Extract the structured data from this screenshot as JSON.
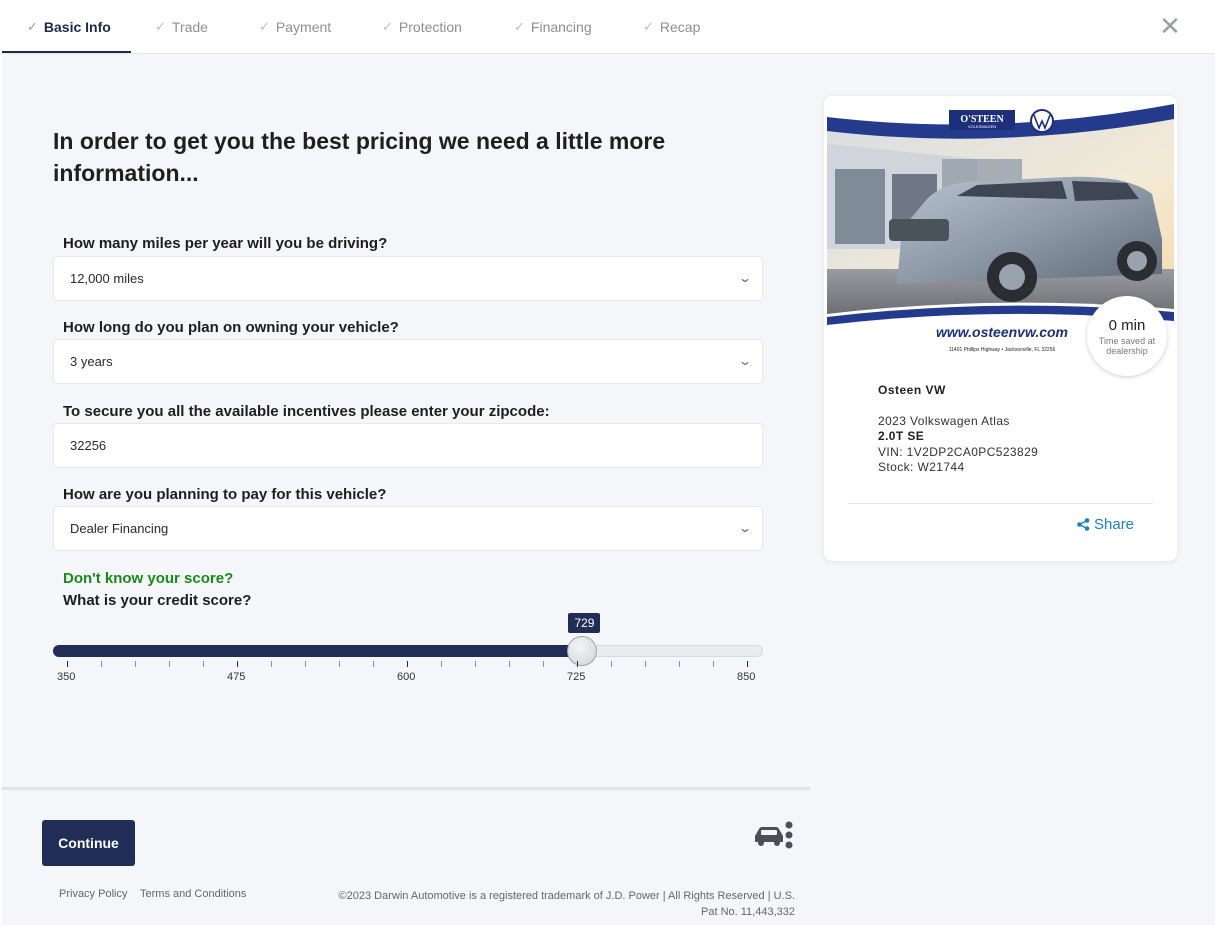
{
  "tabs": [
    {
      "label": "Basic Info",
      "active": true
    },
    {
      "label": "Trade",
      "active": false
    },
    {
      "label": "Payment",
      "active": false
    },
    {
      "label": "Protection",
      "active": false
    },
    {
      "label": "Financing",
      "active": false
    },
    {
      "label": "Recap",
      "active": false
    }
  ],
  "heading": "In order to get you the best pricing we need a little more information...",
  "questions": {
    "miles": {
      "label": "How many miles per year will you be driving?",
      "value": "12,000 miles"
    },
    "owning": {
      "label": "How long do you plan on owning your vehicle?",
      "value": "3 years"
    },
    "zipcode": {
      "label": "To secure you all the available incentives please enter your zipcode:",
      "value": "32256"
    },
    "payment": {
      "label": "How are you planning to pay for this vehicle?",
      "value": "Dealer Financing"
    }
  },
  "credit": {
    "link": "Don't know your score?",
    "label": "What is your credit score?",
    "min": 350,
    "max": 850,
    "value": 729,
    "bubble": "729",
    "tick_labels": [
      "350",
      "475",
      "600",
      "725",
      "850"
    ]
  },
  "footer": {
    "continue": "Continue",
    "privacy": "Privacy Policy",
    "terms": "Terms and Conditions",
    "copyright": "©2023 Darwin Automotive is a registered trademark of J.D. Power | All Rights Reserved | U.S. Pat No. 11,443,332"
  },
  "card": {
    "photo": {
      "dealer_logo": "O'STEEN",
      "dealer_logo_sub": "VOLKSWAGEN",
      "url": "www.osteenvw.com",
      "address": "11401 Phillips Highway • Jacksonville, FL 32256"
    },
    "timer_value": "0 min",
    "timer_sub": "Time saved at dealership",
    "dealer": "Osteen VW",
    "vehicle": "2023 Volkswagen Atlas",
    "trim": "2.0T SE",
    "vin": "VIN: 1V2DP2CA0PC523829",
    "stock": "Stock: W21744",
    "share": "Share"
  },
  "colors": {
    "accent": "#1f2d57",
    "link_green": "#1a8a1a",
    "share_blue": "#1f7ec2",
    "background": "#f5f6fa"
  }
}
